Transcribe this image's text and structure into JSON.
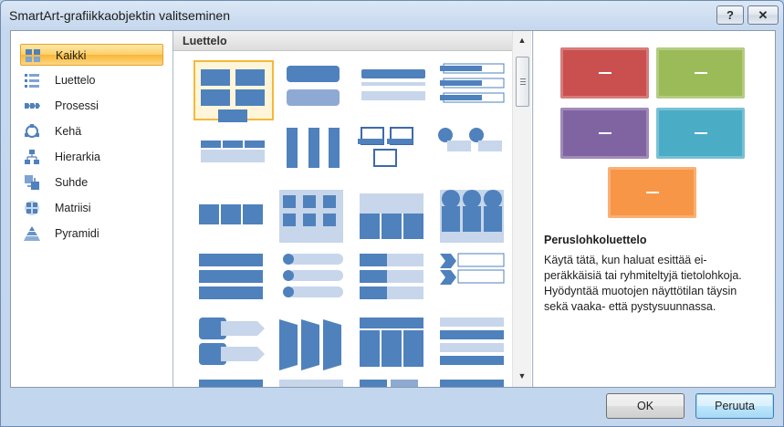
{
  "window": {
    "title": "SmartArt-grafiikkaobjektin valitseminen",
    "help_label": "?",
    "close_label": "✕"
  },
  "categories": [
    {
      "label": "Kaikki",
      "icon": "all-icon",
      "selected": true
    },
    {
      "label": "Luettelo",
      "icon": "list-icon"
    },
    {
      "label": "Prosessi",
      "icon": "process-icon"
    },
    {
      "label": "Kehä",
      "icon": "cycle-icon"
    },
    {
      "label": "Hierarkia",
      "icon": "hierarchy-icon"
    },
    {
      "label": "Suhde",
      "icon": "relationship-icon"
    },
    {
      "label": "Matriisi",
      "icon": "matrix-icon"
    },
    {
      "label": "Pyramidi",
      "icon": "pyramid-icon"
    }
  ],
  "gallery": {
    "section_title": "Luettelo",
    "selected_index": 0,
    "count": 24
  },
  "preview": {
    "title": "Peruslohkoluettelo",
    "description": "Käytä tätä, kun haluat esittää ei-peräkkäisiä tai ryhmiteltyjä tietolohkoja. Hyödyntää muotojen näyttötilan täysin sekä vaaka- että pystysuunnassa.",
    "colors": [
      "#c9504f",
      "#9bbb59",
      "#8064a2",
      "#4bacc6",
      "#f79646"
    ]
  },
  "buttons": {
    "ok": "OK",
    "cancel": "Peruuta"
  },
  "colors": {
    "accent": "#4f81bd",
    "selection": "#f9b737"
  }
}
